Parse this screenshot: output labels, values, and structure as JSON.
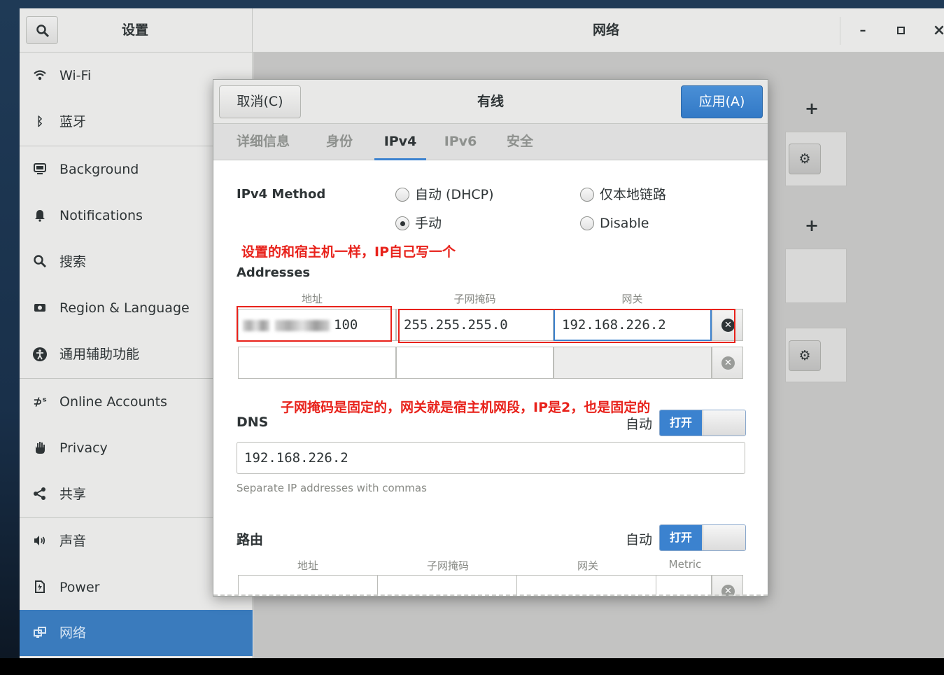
{
  "window": {
    "left_title": "设置",
    "main_title": "网络",
    "minimize": "–",
    "maximize": "▫",
    "close": "×"
  },
  "sidebar": {
    "items": [
      {
        "label": "Wi-Fi",
        "icon": "wifi-icon"
      },
      {
        "label": "蓝牙",
        "icon": "bluetooth-icon"
      },
      {
        "label": "Background",
        "icon": "display-icon"
      },
      {
        "label": "Notifications",
        "icon": "bell-icon"
      },
      {
        "label": "搜索",
        "icon": "search-icon"
      },
      {
        "label": "Region & Language",
        "icon": "camera-icon"
      },
      {
        "label": "通用辅助功能",
        "icon": "accessibility-icon"
      },
      {
        "label": "Online Accounts",
        "icon": "online-accounts-icon"
      },
      {
        "label": "Privacy",
        "icon": "hand-icon"
      },
      {
        "label": "共享",
        "icon": "share-icon"
      },
      {
        "label": "声音",
        "icon": "speaker-icon"
      },
      {
        "label": "Power",
        "icon": "power-icon"
      },
      {
        "label": "网络",
        "icon": "network-icon",
        "active": true
      }
    ]
  },
  "content": {
    "plus": "+",
    "gear": "⚙"
  },
  "dialog": {
    "cancel_label": "取消(C)",
    "title": "有线",
    "apply_label": "应用(A)",
    "tabs": [
      "详细信息",
      "身份",
      "IPv4",
      "IPv6",
      "安全"
    ],
    "active_tab": "IPv4",
    "ipv4_method_label": "IPv4 Method",
    "methods": {
      "auto_dhcp": "自动 (DHCP)",
      "link_local": "仅本地链路",
      "manual": "手动",
      "disable": "Disable",
      "selected": "手动"
    },
    "annotation_top": "设置的和宿主机一样，IP自己写一个",
    "addresses_label": "Addresses",
    "address_headers": [
      "地址",
      "子网掩码",
      "网关"
    ],
    "address_row": {
      "address_visible_suffix": "100",
      "netmask": "255.255.255.0",
      "gateway": "192.168.226.2"
    },
    "annotation_mid": "子网掩码是固定的，网关就是宿主机网段，IP是2，也是固定的",
    "dns": {
      "label": "DNS",
      "auto_label": "自动",
      "switch_on": "打开",
      "value": "192.168.226.2",
      "hint": "Separate IP addresses with commas"
    },
    "routes": {
      "label": "路由",
      "auto_label": "自动",
      "switch_on": "打开",
      "headers": [
        "地址",
        "子网掩码",
        "网关",
        "Metric"
      ]
    }
  },
  "colors": {
    "accent": "#3b82cf",
    "annotation": "#e8221b",
    "sidebar_active": "#3a7bbd"
  }
}
